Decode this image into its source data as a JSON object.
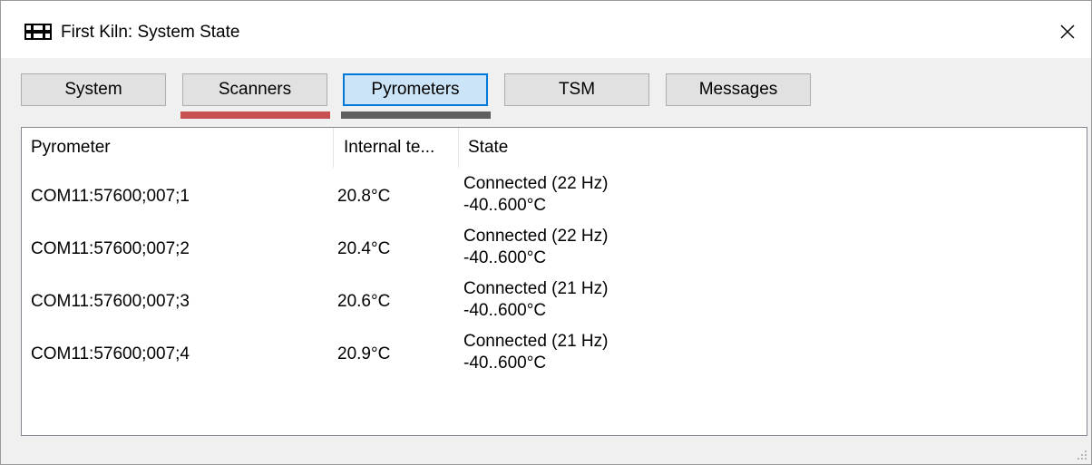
{
  "window": {
    "title": "First Kiln: System State",
    "icon": "kiln-app-icon",
    "close_icon": "close-icon"
  },
  "tabs": [
    {
      "label": "System",
      "active": false,
      "underline_color": ""
    },
    {
      "label": "Scanners",
      "active": false,
      "underline_color": "#c85050"
    },
    {
      "label": "Pyrometers",
      "active": true,
      "underline_color": "#5f5f5f"
    },
    {
      "label": "TSM",
      "active": false,
      "underline_color": ""
    },
    {
      "label": "Messages",
      "active": false,
      "underline_color": ""
    }
  ],
  "table": {
    "columns": [
      "Pyrometer",
      "Internal te...",
      "State"
    ],
    "rows": [
      {
        "pyrometer": "COM11:57600;007;1",
        "internal_temp": "20.8°C",
        "state": "Connected (22 Hz)",
        "range": "-40..600°C"
      },
      {
        "pyrometer": "COM11:57600;007;2",
        "internal_temp": "20.4°C",
        "state": "Connected (22 Hz)",
        "range": "-40..600°C"
      },
      {
        "pyrometer": "COM11:57600;007;3",
        "internal_temp": "20.6°C",
        "state": "Connected (21 Hz)",
        "range": "-40..600°C"
      },
      {
        "pyrometer": "COM11:57600;007;4",
        "internal_temp": "20.9°C",
        "state": "Connected (21 Hz)",
        "range": "-40..600°C"
      }
    ]
  },
  "colors": {
    "active_tab_bg": "#cce4f7",
    "active_tab_border": "#0078d7",
    "scanners_status": "#c85050",
    "pyrometers_status": "#5f5f5f"
  }
}
